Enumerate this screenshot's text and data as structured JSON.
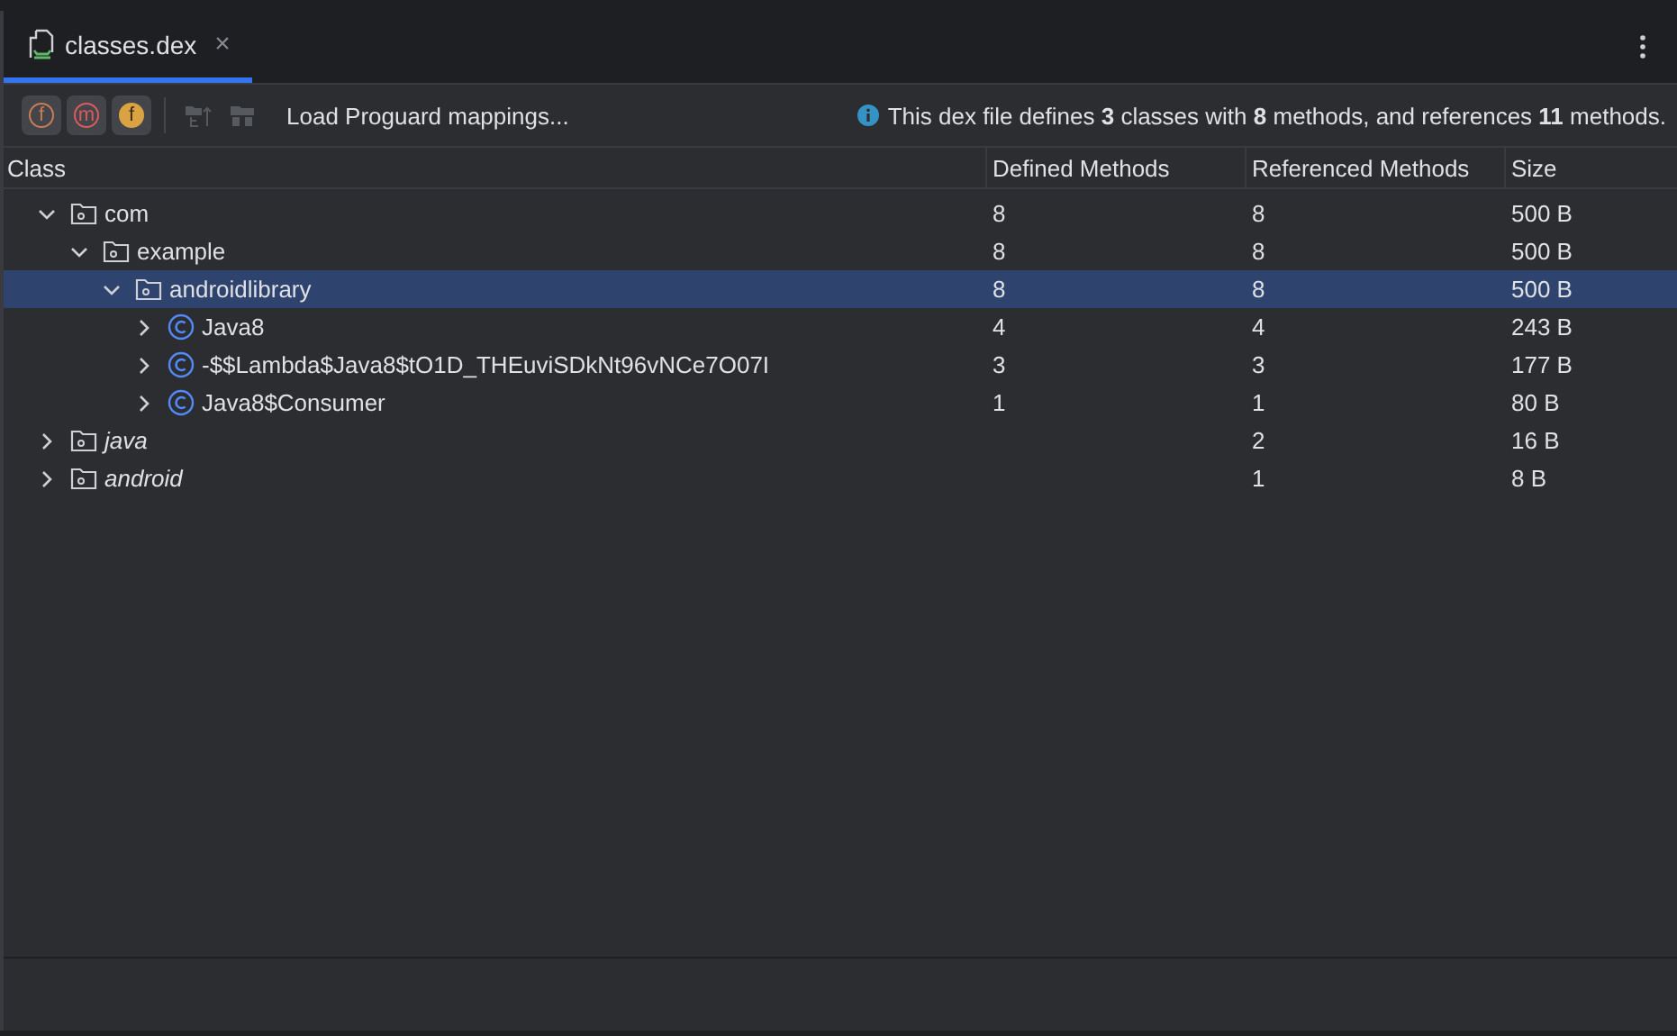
{
  "tab": {
    "title": "classes.dex",
    "selected": true,
    "close": "×"
  },
  "toolbar": {
    "filters": [
      {
        "kind": "field",
        "letter": "f",
        "selected": true
      },
      {
        "kind": "method",
        "letter": "m",
        "selected": true
      },
      {
        "kind": "reference",
        "letter": "f",
        "selected": true
      }
    ],
    "actions": [
      {
        "kind": "tree",
        "disabled": true
      },
      {
        "kind": "rename",
        "disabled": true
      }
    ],
    "load_button": "Load Proguard mappings...",
    "info": "This dex file defines **3** classes with **8** methods, and references **11** methods."
  },
  "table": {
    "columns": [
      "Class",
      "Defined Methods",
      "Referenced Methods",
      "Size"
    ],
    "rows": [
      {
        "name": "com",
        "kind": "package",
        "external": false,
        "expanded": true,
        "selected": false,
        "defined": "8",
        "referenced": "8",
        "size": "500 B",
        "children": [
          {
            "name": "example",
            "kind": "package",
            "external": false,
            "expanded": true,
            "selected": false,
            "defined": "8",
            "referenced": "8",
            "size": "500 B",
            "children": [
              {
                "name": "androidlibrary",
                "kind": "package",
                "external": false,
                "expanded": true,
                "selected": true,
                "defined": "8",
                "referenced": "8",
                "size": "500 B",
                "children": [
                  {
                    "name": "Java8",
                    "kind": "class",
                    "external": false,
                    "expanded": false,
                    "selected": false,
                    "defined": "4",
                    "referenced": "4",
                    "size": "243 B"
                  },
                  {
                    "name": "-$$Lambda$Java8$tO1D_THEuviSDkNt96vNCe7O07I",
                    "kind": "class",
                    "external": false,
                    "expanded": false,
                    "selected": false,
                    "defined": "3",
                    "referenced": "3",
                    "size": "177 B"
                  },
                  {
                    "name": "Java8$Consumer",
                    "kind": "class",
                    "external": false,
                    "expanded": false,
                    "selected": false,
                    "defined": "1",
                    "referenced": "1",
                    "size": "80 B"
                  }
                ]
              }
            ]
          }
        ]
      },
      {
        "name": "java",
        "kind": "package",
        "external": true,
        "expanded": false,
        "selected": false,
        "referenced": "2",
        "size": "16 B"
      },
      {
        "name": "android",
        "kind": "package",
        "external": true,
        "expanded": false,
        "selected": false,
        "referenced": "1",
        "size": "8 B"
      }
    ]
  }
}
